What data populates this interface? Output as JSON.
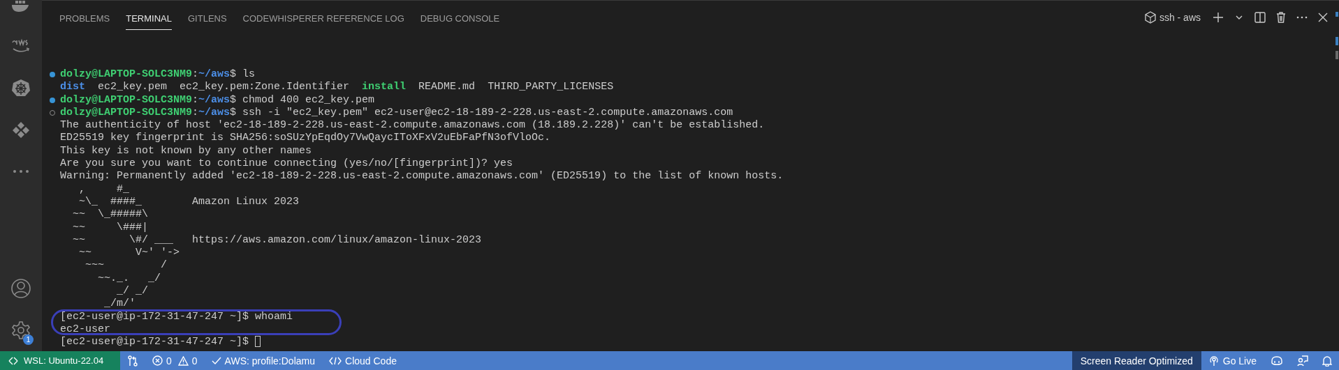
{
  "activity_bar": {
    "settings_badge": "1"
  },
  "panel": {
    "tabs": [
      {
        "label": "PROBLEMS",
        "selected": false
      },
      {
        "label": "TERMINAL",
        "selected": true
      },
      {
        "label": "GITLENS",
        "selected": false
      },
      {
        "label": "CODEWHISPERER REFERENCE LOG",
        "selected": false
      },
      {
        "label": "DEBUG CONSOLE",
        "selected": false
      }
    ],
    "terminal_name": "ssh - aws"
  },
  "terminal": {
    "cursor": true,
    "lines": [
      {
        "kind": "success",
        "segments": [
          {
            "kind": "user",
            "text": "dolzy@LAPTOP-SOLC3NM9"
          },
          {
            "kind": "plain",
            "text": ":"
          },
          {
            "kind": "path",
            "text": "~/aws"
          },
          {
            "kind": "plain",
            "text": "$ ls"
          }
        ]
      },
      {
        "kind": "output",
        "segments": [
          {
            "kind": "path",
            "text": "dist"
          },
          {
            "kind": "plain",
            "text": "  ec2_key.pem  ec2_key.pem:Zone.Identifier  "
          },
          {
            "kind": "user",
            "text": "install"
          },
          {
            "kind": "plain",
            "text": "  README.md  THIRD_PARTY_LICENSES"
          }
        ]
      },
      {
        "kind": "success",
        "segments": [
          {
            "kind": "user",
            "text": "dolzy@LAPTOP-SOLC3NM9"
          },
          {
            "kind": "plain",
            "text": ":"
          },
          {
            "kind": "path",
            "text": "~/aws"
          },
          {
            "kind": "plain",
            "text": "$ chmod 400 ec2_key.pem"
          }
        ]
      },
      {
        "kind": "running",
        "segments": [
          {
            "kind": "user",
            "text": "dolzy@LAPTOP-SOLC3NM9"
          },
          {
            "kind": "plain",
            "text": ":"
          },
          {
            "kind": "path",
            "text": "~/aws"
          },
          {
            "kind": "plain",
            "text": "$ ssh -i \"ec2_key.pem\" ec2-user@ec2-18-189-2-228.us-east-2.compute.amazonaws.com"
          }
        ]
      },
      {
        "kind": "output",
        "segments": [
          {
            "kind": "plain",
            "text": "The authenticity of host 'ec2-18-189-2-228.us-east-2.compute.amazonaws.com (18.189.2.228)' can't be established."
          }
        ]
      },
      {
        "kind": "output",
        "segments": [
          {
            "kind": "plain",
            "text": "ED25519 key fingerprint is SHA256:soSUzYpEqdOy7VwQaycIToXFxV2uEbFaPfN3ofVloOc."
          }
        ]
      },
      {
        "kind": "output",
        "segments": [
          {
            "kind": "plain",
            "text": "This key is not known by any other names"
          }
        ]
      },
      {
        "kind": "output",
        "segments": [
          {
            "kind": "plain",
            "text": "Are you sure you want to continue connecting (yes/no/[fingerprint])? yes"
          }
        ]
      },
      {
        "kind": "output",
        "segments": [
          {
            "kind": "plain",
            "text": "Warning: Permanently added 'ec2-18-189-2-228.us-east-2.compute.amazonaws.com' (ED25519) to the list of known hosts."
          }
        ]
      },
      {
        "kind": "output",
        "segments": [
          {
            "kind": "plain",
            "text": "   ,     #_"
          }
        ]
      },
      {
        "kind": "output",
        "segments": [
          {
            "kind": "plain",
            "text": "   ~\\_  ####_        Amazon Linux 2023"
          }
        ]
      },
      {
        "kind": "output",
        "segments": [
          {
            "kind": "plain",
            "text": "  ~~  \\_#####\\"
          }
        ]
      },
      {
        "kind": "output",
        "segments": [
          {
            "kind": "plain",
            "text": "  ~~     \\###|"
          }
        ]
      },
      {
        "kind": "output",
        "segments": [
          {
            "kind": "plain",
            "text": "  ~~       \\#/ ___   https://aws.amazon.com/linux/amazon-linux-2023"
          }
        ]
      },
      {
        "kind": "output",
        "segments": [
          {
            "kind": "plain",
            "text": "   ~~       V~' '->"
          }
        ]
      },
      {
        "kind": "output",
        "segments": [
          {
            "kind": "plain",
            "text": "    ~~~         /"
          }
        ]
      },
      {
        "kind": "output",
        "segments": [
          {
            "kind": "plain",
            "text": "      ~~._.   _/"
          }
        ]
      },
      {
        "kind": "output",
        "segments": [
          {
            "kind": "plain",
            "text": "         _/ _/"
          }
        ]
      },
      {
        "kind": "output",
        "segments": [
          {
            "kind": "plain",
            "text": "       _/m/'"
          }
        ]
      },
      {
        "kind": "output",
        "segments": [
          {
            "kind": "plain",
            "text": "[ec2-user@ip-172-31-47-247 ~]$ whoami"
          }
        ]
      },
      {
        "kind": "output",
        "segments": [
          {
            "kind": "plain",
            "text": "ec2-user"
          }
        ]
      },
      {
        "kind": "output",
        "segments": [
          {
            "kind": "plain",
            "text": "[ec2-user@ip-172-31-47-247 ~]$ "
          }
        ]
      }
    ]
  },
  "status_bar": {
    "remote": "WSL: Ubuntu-22.04",
    "left": [
      {
        "kind": "source-control"
      },
      {
        "kind": "problems",
        "errors": "0",
        "warnings": "0"
      },
      {
        "kind": "check",
        "label": "AWS: profile:Dolamu"
      },
      {
        "kind": "code",
        "label": "Cloud Code"
      }
    ],
    "right": [
      {
        "kind": "mode",
        "label": "Screen Reader Optimized"
      },
      {
        "kind": "broadcast",
        "label": "Go Live"
      },
      {
        "kind": "copilot"
      },
      {
        "kind": "feedback"
      },
      {
        "kind": "bell"
      }
    ]
  }
}
